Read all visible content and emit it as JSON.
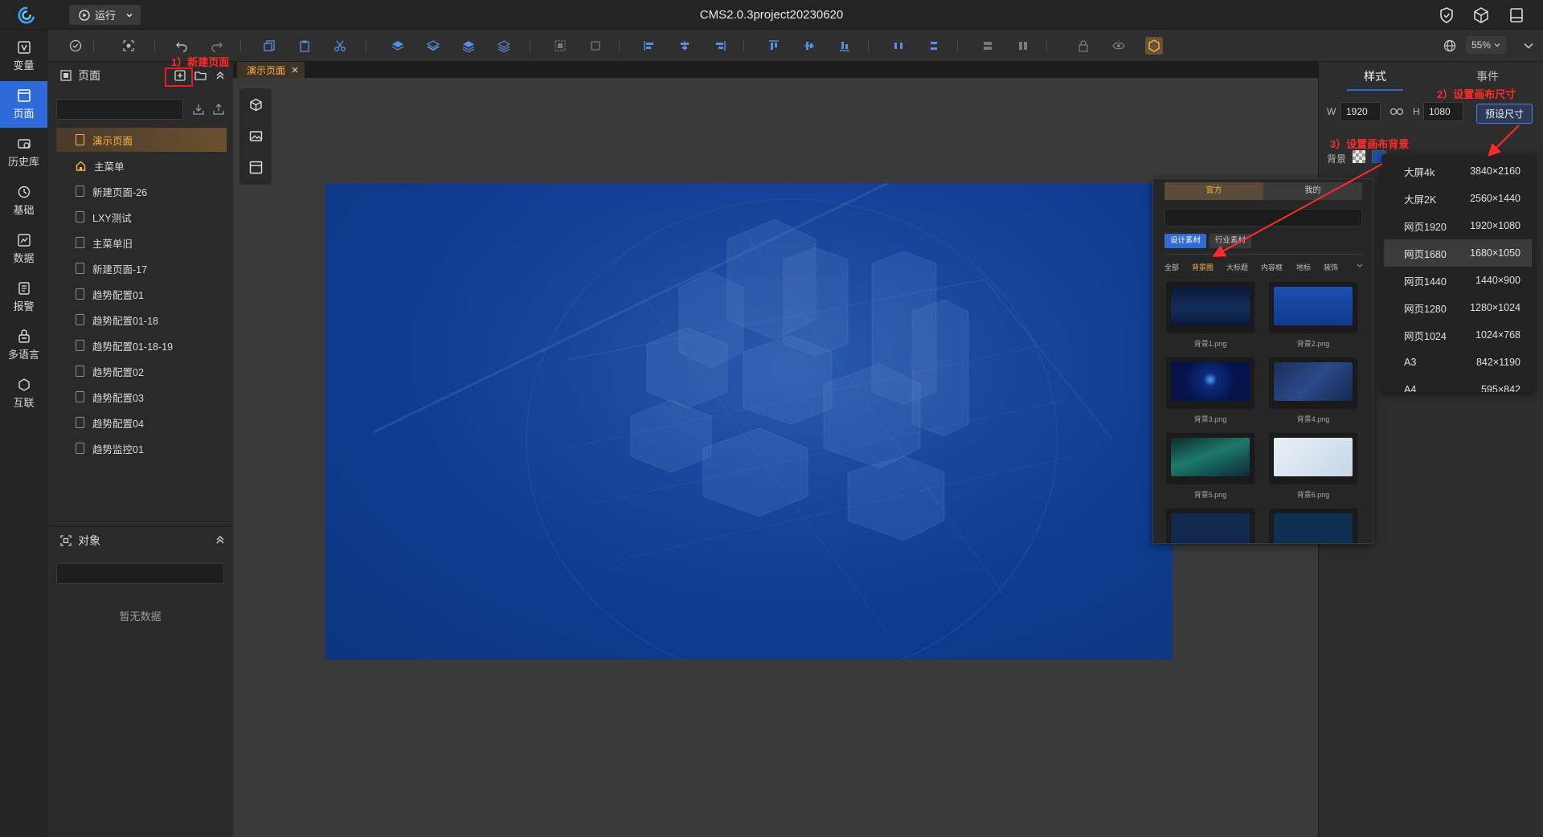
{
  "app": {
    "title": "CMS2.0.3project20230620",
    "run_label": "运行"
  },
  "toolbar": {
    "zoom": "55%"
  },
  "rail": [
    {
      "label": "变量",
      "icon": "variable-icon"
    },
    {
      "label": "页面",
      "icon": "page-icon"
    },
    {
      "label": "历史库",
      "icon": "history-icon"
    },
    {
      "label": "基础",
      "icon": "basic-icon"
    },
    {
      "label": "数据",
      "icon": "data-icon"
    },
    {
      "label": "报警",
      "icon": "alarm-icon"
    },
    {
      "label": "多语言",
      "icon": "language-icon"
    },
    {
      "label": "互联",
      "icon": "interconnect-icon"
    }
  ],
  "pages_panel": {
    "title": "页面",
    "pages": [
      "演示页面",
      "主菜单",
      "新建页面-26",
      "LXY测试",
      "主菜单旧",
      "新建页面-17",
      "趋势配置01",
      "趋势配置01-18",
      "趋势配置01-18-19",
      "趋势配置02",
      "趋势配置03",
      "趋势配置04",
      "趋势监控01"
    ]
  },
  "objects_panel": {
    "title": "对象",
    "empty": "暂无数据"
  },
  "tab": {
    "label": "演示页面"
  },
  "right_panel": {
    "tabs": [
      "样式",
      "事件"
    ],
    "w_label": "W",
    "w_value": "1920",
    "h_label": "H",
    "h_value": "1080",
    "preset_label": "预设尺寸",
    "bg_label": "背景"
  },
  "presets": [
    {
      "name": "大屏4k",
      "size": "3840×2160"
    },
    {
      "name": "大屏2K",
      "size": "2560×1440"
    },
    {
      "name": "网页1920",
      "size": "1920×1080"
    },
    {
      "name": "网页1680",
      "size": "1680×1050"
    },
    {
      "name": "网页1440",
      "size": "1440×900"
    },
    {
      "name": "网页1280",
      "size": "1280×1024"
    },
    {
      "name": "网页1024",
      "size": "1024×768"
    },
    {
      "name": "A3",
      "size": "842×1190"
    },
    {
      "name": "A4",
      "size": "595×842"
    }
  ],
  "bg_picker": {
    "tabs": [
      "官方",
      "我的"
    ],
    "chips": [
      "设计素材",
      "行业素材"
    ],
    "categories": [
      "全部",
      "背景图",
      "大标题",
      "内容框",
      "地标",
      "装饰"
    ],
    "thumbs": [
      "背景1.png",
      "背景2.png",
      "背景3.png",
      "背景4.png",
      "背景5.png",
      "背景6.png"
    ]
  },
  "annotations": {
    "step1": "1）新建页面",
    "step2": "2）设置画布尺寸",
    "step3": "3）设置画布背景"
  },
  "colors": {
    "accent": "#2f6bd8",
    "active_page": "#ffb347",
    "annotation": "#ff2a2a"
  }
}
